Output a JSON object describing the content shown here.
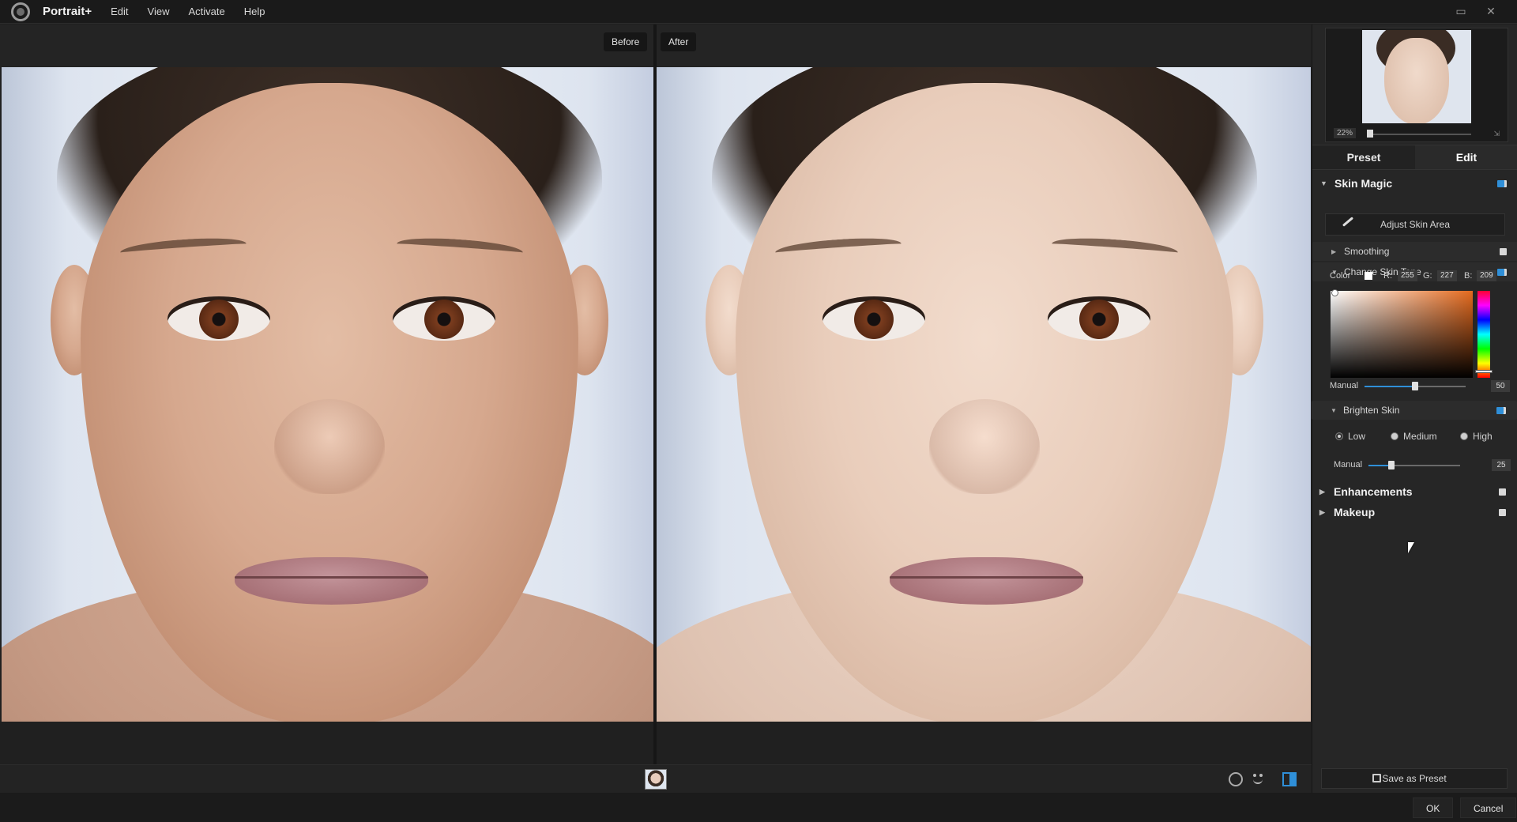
{
  "app": {
    "title": "Portrait+",
    "menu": [
      "Edit",
      "View",
      "Activate",
      "Help"
    ]
  },
  "window_controls": [
    "maximize-icon",
    "close-icon"
  ],
  "view": {
    "before_label": "Before",
    "after_label": "After"
  },
  "navigator": {
    "zoom": "22%"
  },
  "panel": {
    "tabs": [
      "Preset",
      "Edit"
    ],
    "active_tab": "Edit",
    "skin_magic": {
      "title": "Skin Magic",
      "adjust_button": "Adjust Skin Area",
      "smoothing": "Smoothing",
      "change_skin_tone": "Change Skin Tone",
      "color_label": "Color",
      "r_label": "R:",
      "r": "255",
      "g_label": "G:",
      "g": "227",
      "b_label": "B:",
      "b": "209",
      "manual_label": "Manual",
      "manual_value": "50",
      "brighten_skin": "Brighten Skin",
      "brighten_options": [
        "Low",
        "Medium",
        "High"
      ],
      "brighten_selected": "Low",
      "brighten_manual_label": "Manual",
      "brighten_manual_value": "25"
    },
    "enhancements": "Enhancements",
    "makeup": "Makeup",
    "save_preset": "Save as Preset"
  },
  "footer": {
    "ok": "OK",
    "cancel": "Cancel"
  },
  "colors": {
    "accent": "#2f8fd8",
    "background": "#202020",
    "panel": "#262626"
  }
}
